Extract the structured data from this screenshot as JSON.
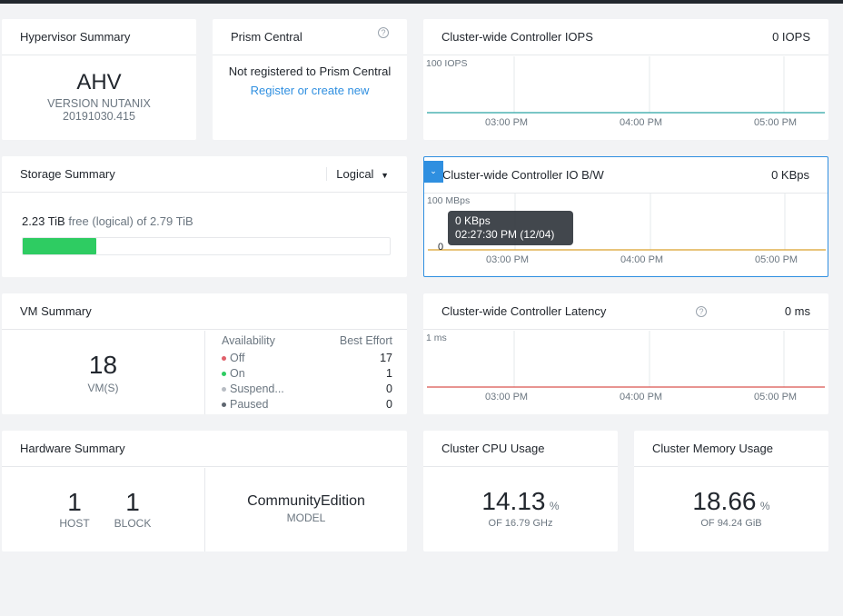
{
  "hypervisor": {
    "title": "Hypervisor Summary",
    "name": "AHV",
    "version_line": "VERSION NUTANIX",
    "version": "20191030.415"
  },
  "prism": {
    "title": "Prism Central",
    "status": "Not registered to Prism Central",
    "link": "Register or create new"
  },
  "iops": {
    "title": "Cluster-wide Controller IOPS",
    "value": "0 IOPS",
    "ymax": "100 IOPS",
    "xticks": [
      "03:00 PM",
      "04:00 PM",
      "05:00 PM"
    ],
    "line_color": "#2aa5a5"
  },
  "iobw": {
    "title": "Cluster-wide Controller IO B/W",
    "value": "0 KBps",
    "ymax": "100 MBps",
    "xticks": [
      "03:00 PM",
      "04:00 PM",
      "05:00 PM"
    ],
    "line_color": "#d9a02c",
    "tooltip": {
      "value": "0 KBps",
      "time": "02:27:30 PM (12/04)"
    },
    "marker": "0"
  },
  "latency": {
    "title": "Cluster-wide Controller Latency",
    "value": "0 ms",
    "ymax": "1 ms",
    "xticks": [
      "03:00 PM",
      "04:00 PM",
      "05:00 PM"
    ],
    "line_color": "#d9534f"
  },
  "storage": {
    "title": "Storage Summary",
    "mode": "Logical",
    "free": "2.23",
    "free_unit": "TiB",
    "free_text": "free (logical) of 2.79 TiB",
    "used_fraction": 0.2,
    "bar_color": "#2ecc62"
  },
  "vm": {
    "title": "VM Summary",
    "count": "18",
    "count_label": "VM(S)",
    "col1": "Availability",
    "col2": "Best Effort",
    "rows": [
      {
        "label": "Off",
        "value": "17",
        "color": "#e0606a"
      },
      {
        "label": "On",
        "value": "1",
        "color": "#2ecc62"
      },
      {
        "label": "Suspend...",
        "value": "0",
        "color": "#b7bcc3"
      },
      {
        "label": "Paused",
        "value": "0",
        "color": "#5e6670"
      }
    ]
  },
  "hardware": {
    "title": "Hardware Summary",
    "hosts": "1",
    "hosts_label": "HOST",
    "blocks": "1",
    "blocks_label": "BLOCK",
    "model": "CommunityEdition",
    "model_label": "MODEL"
  },
  "cpu": {
    "title": "Cluster CPU Usage",
    "value": "14.13",
    "unit": "%",
    "of": "OF 16.79 GHz"
  },
  "memory": {
    "title": "Cluster Memory Usage",
    "value": "18.66",
    "unit": "%",
    "of": "OF 94.24 GiB"
  }
}
